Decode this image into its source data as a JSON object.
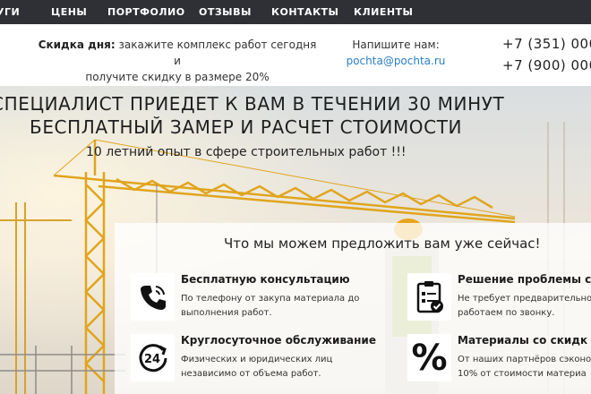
{
  "nav": {
    "items": [
      {
        "label": "УГИ"
      },
      {
        "label": "ЦЕНЫ"
      },
      {
        "label": "ПОРТФОЛИО"
      },
      {
        "label": "ОТЗЫВЫ"
      },
      {
        "label": "КОНТАКТЫ"
      },
      {
        "label": "КЛИЕНТЫ"
      }
    ]
  },
  "infobar": {
    "promo_bold": "Скидка дня:",
    "promo_line1": " закажите комплекс работ сегодня и",
    "promo_line2": "получите скидку в размере 20%",
    "write_label": "Напишите нам:",
    "email": "pochta@pochta.ru",
    "phones": [
      "+7 (351) 000",
      "+7 (900) 000"
    ]
  },
  "hero": {
    "headline1": "СПЕЦИАЛИСТ ПРИЕДЕТ К ВАМ В ТЕЧЕНИИ 30 МИНУТ",
    "headline2": "БЕСПЛАТНЫЙ ЗАМЕР И РАСЧЕТ СТОИМОСТИ",
    "subline": "10 летний опыт в сфере строительных работ !!!"
  },
  "offer": {
    "title": "Что мы можем предложить вам уже сейчас!",
    "features": [
      {
        "icon": "phone-icon",
        "title": "Бесплатную консультацию",
        "desc1": "По телефону от закупа материала до",
        "desc2": "выполнения работ."
      },
      {
        "icon": "checklist-icon",
        "title": "Решение проблемы с",
        "desc1": "Не требует предварительно",
        "desc2": "работаем по звонку."
      },
      {
        "icon": "clock-24-icon",
        "title": "Круглосуточное обслуживание",
        "desc1": "Физических и юридических лиц",
        "desc2": "независимо от объема работ."
      },
      {
        "icon": "percent-icon",
        "icon_text": "%",
        "title": "Материалы со скидк",
        "desc1": "От наших партнёров сэконо",
        "desc2": "10% от стоимости материа"
      }
    ]
  }
}
